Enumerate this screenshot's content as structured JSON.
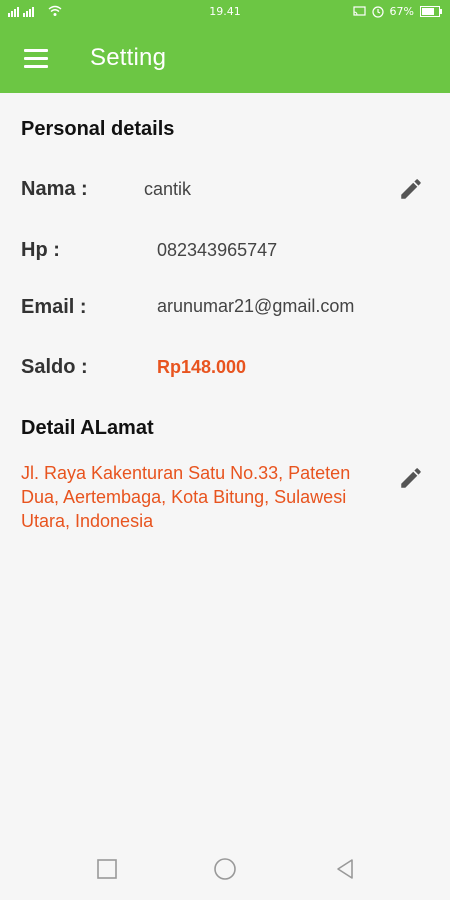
{
  "status_bar": {
    "signal_text": "͐͐",
    "time": "19.41",
    "battery": "67%"
  },
  "app_bar": {
    "title": "Setting",
    "menu_icon": "hamburger-menu-icon"
  },
  "personal_details": {
    "heading": "Personal details",
    "nama_label": "Nama :",
    "nama_value": "cantik",
    "hp_label": "Hp :",
    "hp_value": "082343965747",
    "email_label": "Email :",
    "email_value": "arunumar21@gmail.com",
    "saldo_label": "Saldo :",
    "saldo_value": "Rp148.000"
  },
  "address": {
    "heading": "Detail ALamat",
    "text": "Jl. Raya Kakenturan Satu No.33, Pateten Dua, Aertembaga, Kota Bitung, Sulawesi Utara, Indonesia"
  },
  "colors": {
    "primary": "#6cc644",
    "accent": "#e8541f",
    "background": "#f6f6f6"
  },
  "icons": [
    "pencil-edit-icon",
    "square-recents-icon",
    "circle-home-icon",
    "triangle-back-icon"
  ]
}
